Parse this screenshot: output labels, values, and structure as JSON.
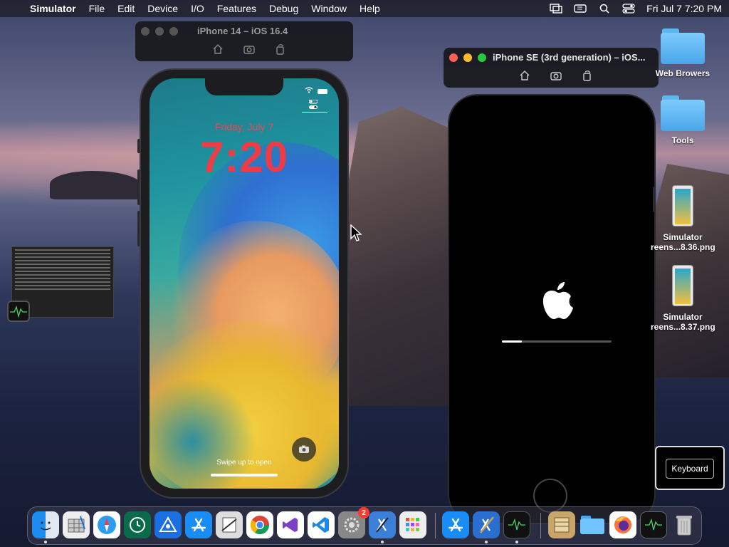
{
  "menubar": {
    "app_name": "Simulator",
    "items": [
      "File",
      "Edit",
      "Device",
      "I/O",
      "Features",
      "Debug",
      "Window",
      "Help"
    ],
    "datetime": "Fri Jul 7  7:20 PM"
  },
  "sim_iphone14": {
    "title": "iPhone 14 – iOS 16.4",
    "lock_date": "Friday, July 7",
    "lock_time": "7:20",
    "swipe_text": "Swipe up to open"
  },
  "sim_iphonese": {
    "title": "iPhone SE (3rd generation) – iOS...",
    "boot_progress": 0.18
  },
  "desktop": {
    "icons": [
      {
        "label": "Web Browers"
      },
      {
        "label": "Tools"
      },
      {
        "label": "Simulator\nreens...8.36.png"
      },
      {
        "label": "Simulator\nreens...8.37.png"
      }
    ]
  },
  "keyboard_popup": {
    "label": "Keyboard"
  },
  "dock": {
    "badge_count": "2"
  },
  "colors": {
    "traffic_red": "#ff5f57",
    "traffic_yellow": "#febc2e",
    "traffic_green": "#28c840",
    "lock_red": "#ef3b45"
  }
}
